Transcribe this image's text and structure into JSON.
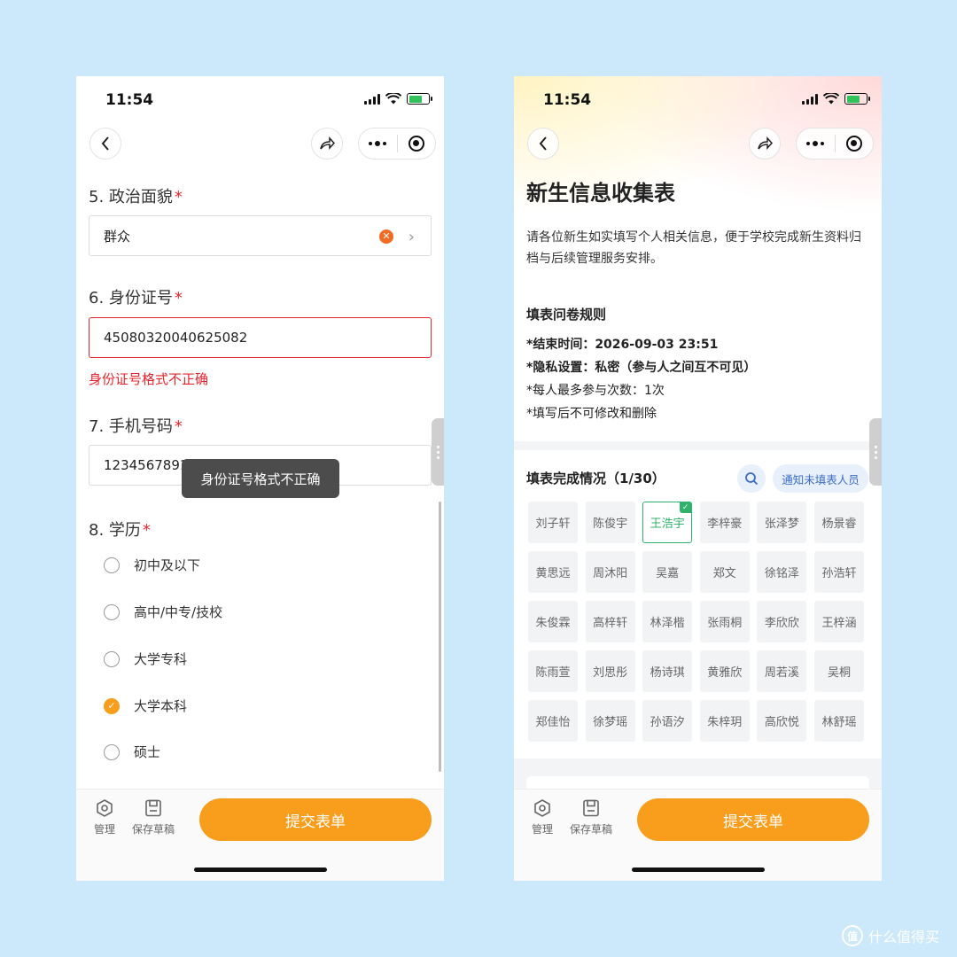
{
  "status": {
    "time": "11:54"
  },
  "left": {
    "q5": {
      "number": "5.",
      "label": "政治面貌",
      "required": "*",
      "value": "群众"
    },
    "q6": {
      "number": "6.",
      "label": "身份证号",
      "required": "*",
      "value": "45080320040625082",
      "error": "身份证号格式不正确"
    },
    "q7": {
      "number": "7.",
      "label": "手机号码",
      "required": "*",
      "value": "1234567891"
    },
    "toast": "身份证号格式不正确",
    "q8": {
      "number": "8.",
      "label": "学历",
      "required": "*",
      "options": [
        {
          "label": "初中及以下",
          "selected": false
        },
        {
          "label": "高中/中专/技校",
          "selected": false
        },
        {
          "label": "大学专科",
          "selected": false
        },
        {
          "label": "大学本科",
          "selected": true
        },
        {
          "label": "硕士",
          "selected": false
        }
      ]
    }
  },
  "bottom": {
    "manage_label": "管理",
    "draft_label": "保存草稿",
    "submit_label": "提交表单"
  },
  "right": {
    "title": "新生信息收集表",
    "description": "请各位新生如实填写个人相关信息，便于学校完成新生资料归档与后续管理服务安排。",
    "rules": {
      "heading": "填表问卷规则",
      "items": [
        "*结束时间：2026-09-03 23:51",
        "*隐私设置：私密（参与人之间互不可见）",
        "*每人最多参与次数：1次",
        "*填写后不可修改和删除"
      ]
    },
    "completion": {
      "heading": "填表完成情况（1/30）",
      "notify_label": "通知未填表人员",
      "names": [
        "刘子轩",
        "陈俊宇",
        "王浩宇",
        "李梓豪",
        "张泽梦",
        "杨景睿",
        "黄思远",
        "周沐阳",
        "吴嘉",
        "郑文",
        "徐铭泽",
        "孙浩轩",
        "朱俊霖",
        "高梓轩",
        "林泽楷",
        "张雨桐",
        "李欣欣",
        "王梓涵",
        "陈雨萱",
        "刘思彤",
        "杨诗琪",
        "黄雅欣",
        "周若溪",
        "吴桐",
        "郑佳怡",
        "徐梦瑶",
        "孙语汐",
        "朱梓玥",
        "高欣悦",
        "林舒瑶"
      ],
      "completed_index": 2
    }
  },
  "watermark": {
    "logo": "值",
    "text": "什么值得买"
  },
  "colors": {
    "accent": "#f99d1c",
    "error": "#e5252e",
    "done": "#2fb36b",
    "link": "#3a6cc8",
    "background": "#cce9fb"
  }
}
